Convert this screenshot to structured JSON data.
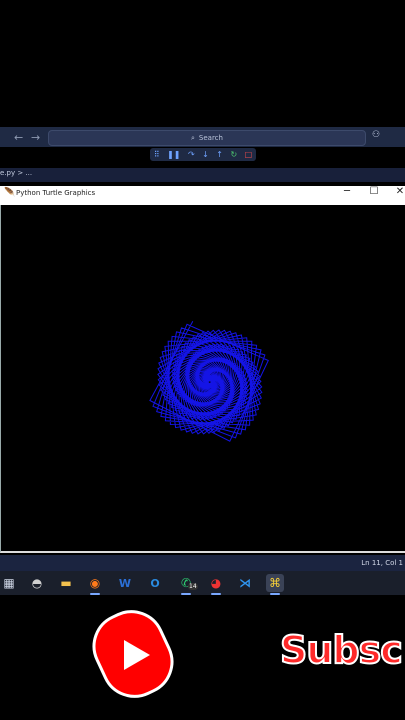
{
  "vscode": {
    "search_placeholder": "Search",
    "breadcrumb": "e.py > ..."
  },
  "turtle_window": {
    "title": "Python Turtle Graphics"
  },
  "statusbar": {
    "position": "Ln 11, Col 1"
  },
  "taskbar": {
    "icons": [
      "start-icon",
      "game-icon",
      "file-explorer-icon",
      "firefox-icon",
      "word-icon",
      "outlook-icon",
      "whatsapp-icon",
      "chrome-remote-icon",
      "vscode-icon",
      "python-icon"
    ],
    "whatsapp_badge": "14"
  },
  "overlay": {
    "subscribe_text": "Subsc"
  },
  "colors": {
    "spiral": "#1414e6",
    "subscribe": "#ff2a2a"
  }
}
